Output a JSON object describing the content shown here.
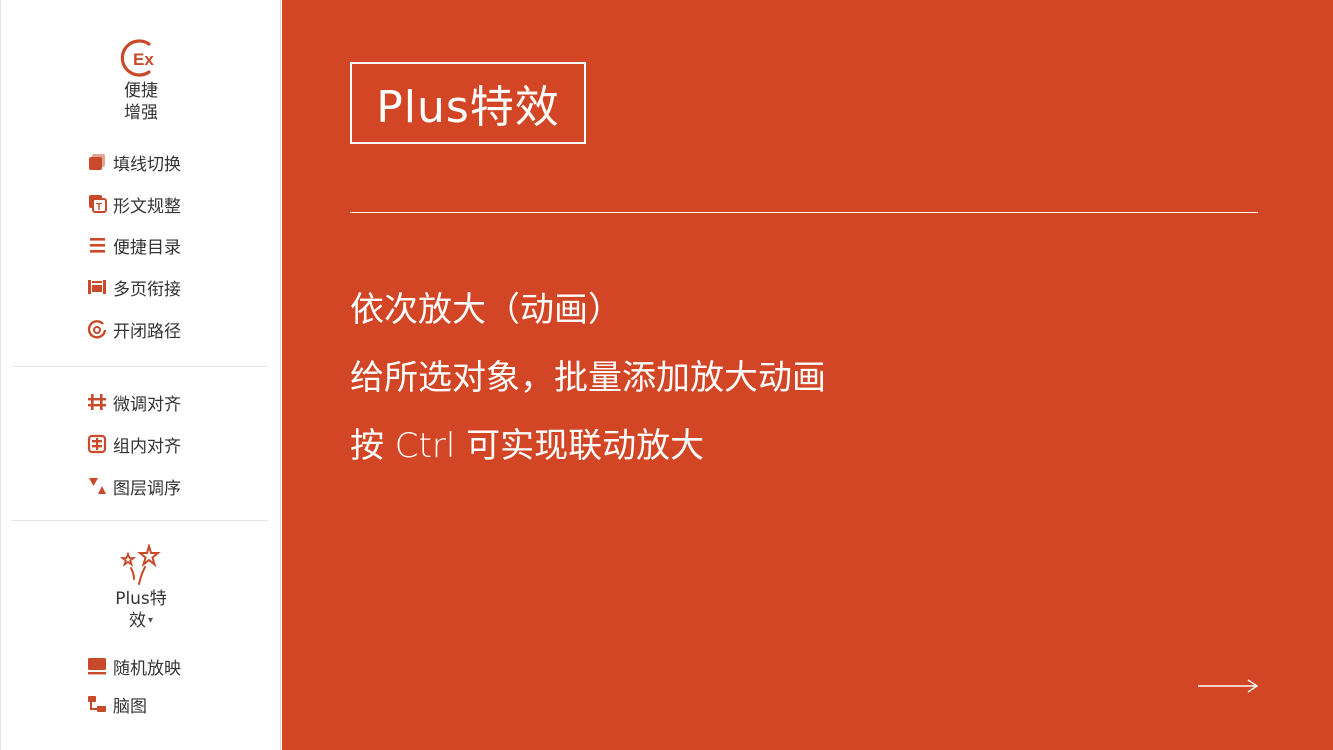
{
  "sidebar": {
    "top_button": {
      "label_line1": "便捷",
      "label_line2": "增强",
      "icon_text": "Ex"
    },
    "group1": [
      {
        "label": "填线切换",
        "icon": "fill-line-icon"
      },
      {
        "label": "形文规整",
        "icon": "shape-text-icon"
      },
      {
        "label": "便捷目录",
        "icon": "list-icon"
      },
      {
        "label": "多页衔接",
        "icon": "page-connect-icon"
      },
      {
        "label": "开闭路径",
        "icon": "path-icon"
      }
    ],
    "group2": [
      {
        "label": "微调对齐",
        "icon": "fine-align-icon"
      },
      {
        "label": "组内对齐",
        "icon": "group-align-icon"
      },
      {
        "label": "图层调序",
        "icon": "layer-order-icon"
      }
    ],
    "plus_button": {
      "label_line1": "Plus特",
      "label_line2": "效",
      "caret": "▾"
    },
    "group3": [
      {
        "label": "随机放映",
        "icon": "random-play-icon"
      },
      {
        "label": "脑图",
        "icon": "mindmap-icon"
      }
    ]
  },
  "slide": {
    "title": "Plus特效",
    "line1": "依次放大（动画）",
    "line2": "给所选对象，批量添加放大动画",
    "line3": "按 Ctrl 可实现联动放大"
  },
  "colors": {
    "accent": "#d24625",
    "sidebar_icon": "#c94a2a",
    "text": "#333333"
  }
}
